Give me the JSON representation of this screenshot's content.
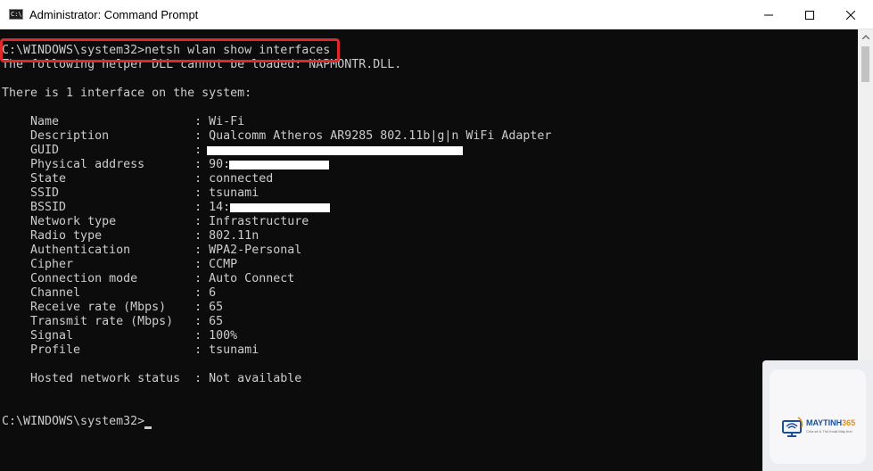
{
  "window": {
    "title": "Administrator: Command Prompt",
    "icon_text": "C:\\",
    "controls": [
      "minimize-icon",
      "maximize-icon",
      "close-icon"
    ]
  },
  "terminal": {
    "lines": [
      "C:\\WINDOWS\\system32>netsh wlan show interfaces",
      "The following helper DLL cannot be loaded: NAPMONTR.DLL.",
      "",
      "There is 1 interface on the system:",
      "",
      "    Name                   : Wi-Fi",
      "    Description            : Qualcomm Atheros AR9285 802.11b|g|n WiFi Adapter",
      "    GUID                   : ",
      "    Physical address       : 90:",
      "    State                  : connected",
      "    SSID                   : tsunami",
      "    BSSID                  : 14:c",
      "    Network type           : Infrastructure",
      "    Radio type             : 802.11n",
      "    Authentication         : WPA2-Personal",
      "    Cipher                 : CCMP",
      "    Connection mode        : Auto Connect",
      "    Channel                : 6",
      "    Receive rate (Mbps)    : 65",
      "    Transmit rate (Mbps)   : 65",
      "    Signal                 : 100%",
      "    Profile                : tsunami",
      "",
      "    Hosted network status  : Not available",
      "",
      "",
      "C:\\WINDOWS\\system32>"
    ],
    "foreground": "#cccccc",
    "background": "#0c0c0c",
    "highlight_color": "#e0282b"
  },
  "watermark": {
    "brand_main": "MAYTINH",
    "brand_accent": "365",
    "tagline": "Chia sẻ & Thủ thuật Máy tính"
  }
}
